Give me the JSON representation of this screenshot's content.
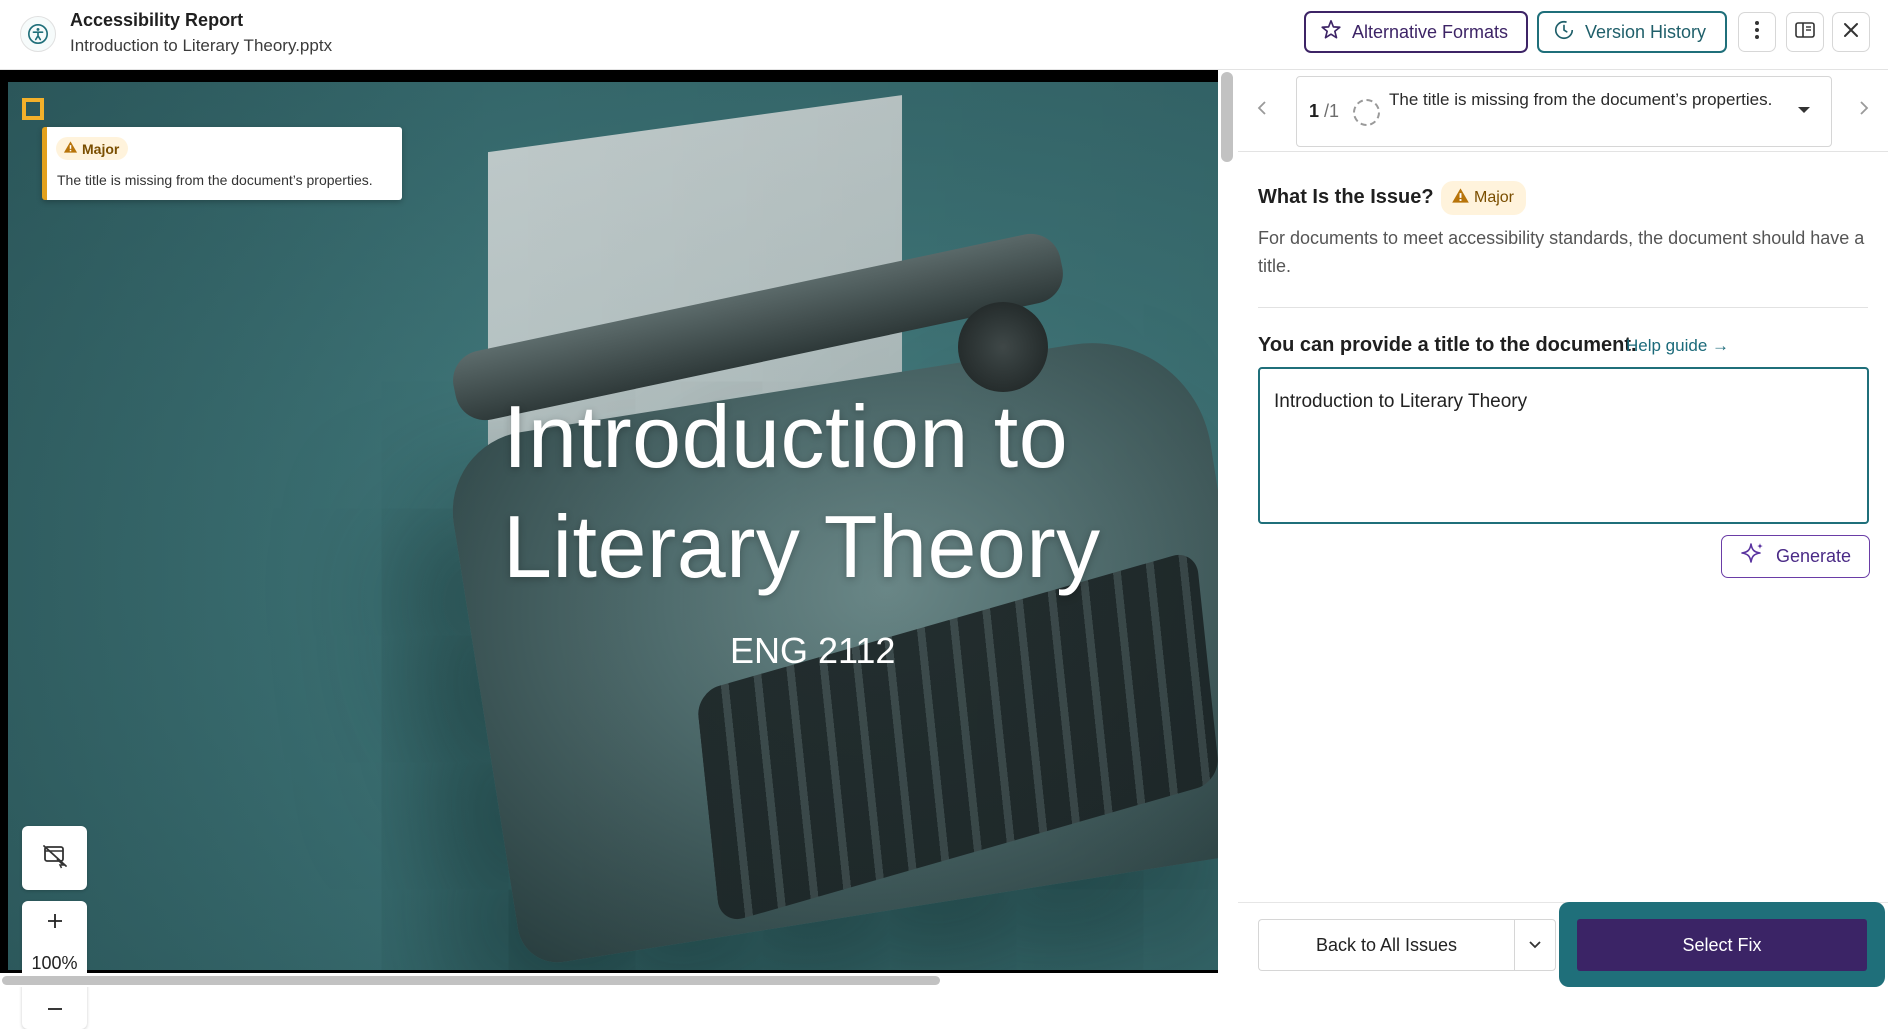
{
  "header": {
    "app_title": "Accessibility Report",
    "document_name": "Introduction to Literary Theory.pptx",
    "alternative_formats_label": "Alternative Formats",
    "version_history_label": "Version History"
  },
  "viewer": {
    "slide": {
      "title_line1": "Introduction to",
      "title_line2": "Literary Theory",
      "subtitle": "ENG 2112"
    },
    "issue_tooltip": {
      "severity": "Major",
      "text": "The title is missing from the document’s properties."
    },
    "zoom": {
      "value": "100%"
    }
  },
  "panel": {
    "issue_nav": {
      "current": "1",
      "total": "/1",
      "selected_issue": "The title is missing from the document’s properties."
    },
    "issue": {
      "heading": "What Is the Issue?",
      "severity": "Major",
      "description": "For documents to meet accessibility standards, the document should have a title."
    },
    "fix": {
      "heading": "You can provide a title to the document.",
      "help_link": "Help guide →",
      "title_value": "Introduction to Literary Theory",
      "generate_label": "Generate"
    },
    "footer": {
      "back_label": "Back to All Issues",
      "select_fix_label": "Select Fix"
    }
  },
  "colors": {
    "brand_purple": "#3b2466",
    "brand_teal": "#1f6f7a",
    "major_amber": "#e2a11d"
  },
  "icons": [
    "accessibility-icon",
    "star-person-icon",
    "history-icon",
    "more-vertical-icon",
    "panel-layout-icon",
    "close-icon",
    "warning-icon",
    "chevron-left-icon",
    "chevron-right-icon",
    "chevron-down-icon",
    "sparkle-icon",
    "hide-annotations-icon",
    "plus-icon",
    "minus-icon"
  ]
}
